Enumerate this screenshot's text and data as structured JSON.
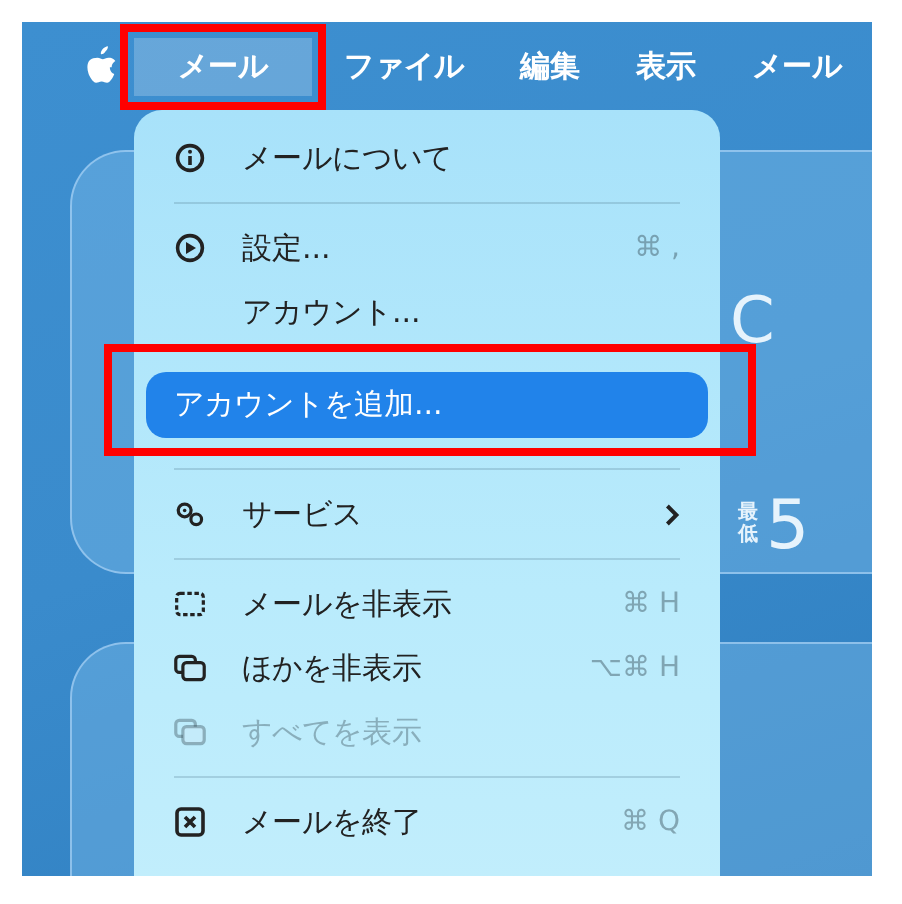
{
  "menu_bar": {
    "items": [
      {
        "label": "メール",
        "selected": true,
        "annotated": true
      },
      {
        "label": "ファイル",
        "selected": false,
        "annotated": false
      },
      {
        "label": "編集",
        "selected": false,
        "annotated": false
      },
      {
        "label": "表示",
        "selected": false,
        "annotated": false
      },
      {
        "label": "メール",
        "selected": false,
        "annotated": false
      }
    ]
  },
  "background": {
    "texts": [
      "C",
      "最低",
      "5"
    ]
  },
  "menu": {
    "groups": [
      [
        {
          "label": "メールについて",
          "kind": "info",
          "selected": false,
          "disabled": false,
          "submenu": false,
          "annotated": false
        }
      ],
      [
        {
          "label": "設定...",
          "kind": "settings",
          "shortcut": "⌘ ,",
          "selected": false,
          "disabled": false,
          "submenu": false,
          "annotated": false
        },
        {
          "label": "アカウント...",
          "kind": "plain",
          "selected": false,
          "disabled": false,
          "submenu": false,
          "annotated": false
        },
        {
          "label": "アカウントを追加...",
          "kind": "plain",
          "selected": true,
          "disabled": false,
          "submenu": false,
          "annotated": true
        }
      ],
      [
        {
          "label": "サービス",
          "kind": "services",
          "selected": false,
          "disabled": false,
          "submenu": true,
          "annotated": false
        }
      ],
      [
        {
          "label": "メールを非表示",
          "kind": "hide",
          "shortcut": "⌘ H",
          "selected": false,
          "disabled": false,
          "submenu": false,
          "annotated": false
        },
        {
          "label": "ほかを非表示",
          "kind": "windows",
          "shortcut": "⌥⌘ H",
          "selected": false,
          "disabled": false,
          "submenu": false,
          "annotated": false
        },
        {
          "label": "すべてを表示",
          "kind": "windows",
          "selected": false,
          "disabled": true,
          "submenu": false,
          "annotated": false
        }
      ],
      [
        {
          "label": "メールを終了",
          "kind": "quit",
          "shortcut": "⌘ Q",
          "selected": false,
          "disabled": false,
          "submenu": false,
          "annotated": false
        }
      ]
    ]
  }
}
